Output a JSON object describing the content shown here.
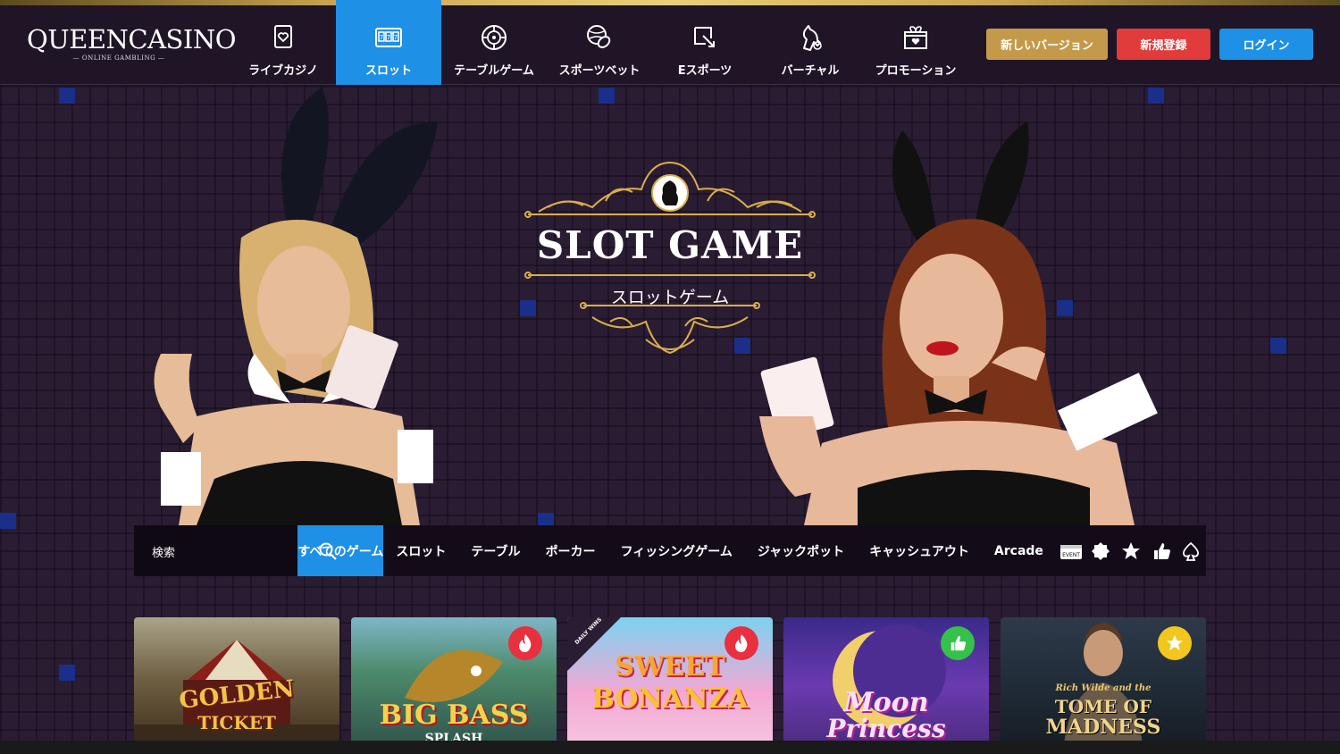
{
  "brand": {
    "name": "QueenCasino",
    "logo_text": "QUEENCASINO",
    "logo_sub": "— ONLINE GAMBLING —"
  },
  "nav": {
    "items": [
      {
        "label": "ライブカジノ",
        "icon": "live-casino-icon"
      },
      {
        "label": "スロット",
        "icon": "slot-777-icon",
        "active": true
      },
      {
        "label": "テーブルゲーム",
        "icon": "roulette-icon"
      },
      {
        "label": "スポーツベット",
        "icon": "sports-balls-icon"
      },
      {
        "label": "Eスポーツ",
        "icon": "esports-icon"
      },
      {
        "label": "バーチャル",
        "icon": "horse-icon"
      },
      {
        "label": "プロモーション",
        "icon": "gift-icon"
      }
    ]
  },
  "header_buttons": {
    "new_version": "新しいバージョン",
    "register": "新規登録",
    "login": "ログイン"
  },
  "hero": {
    "title": "SLOT GAME",
    "subtitle": "スロットゲーム"
  },
  "filter": {
    "search_placeholder": "検索",
    "tabs": [
      "すべてのゲーム",
      "スロット",
      "テーブル",
      "ポーカー",
      "フィッシングゲーム",
      "ジャックポット",
      "キャッシュアウト",
      "Arcade"
    ],
    "active_tab": "すべてのゲーム",
    "icons": [
      "event-icon",
      "badge-icon",
      "star-icon",
      "thumbs-up-icon",
      "spade-icon"
    ],
    "event_label": "EVENT"
  },
  "games": [
    {
      "title_line1": "GOLDEN",
      "title_line2": "TICKET",
      "badge": null
    },
    {
      "title_line1": "BIG BASS",
      "title_line2": "SPLASH",
      "badge": "hot"
    },
    {
      "title_line1": "SWEET",
      "title_line2": "BONANZA",
      "badge": "hot",
      "corner": "DAILY WINS"
    },
    {
      "title_line1": "Moon",
      "title_line2": "Princess",
      "badge": "recommended"
    },
    {
      "title_line0": "Rich Wilde and the",
      "title_line1": "TOME OF",
      "title_line2": "MADNESS",
      "badge": "favorite"
    }
  ],
  "colors": {
    "accent": "#1e90e6",
    "gold": "#c49a4a",
    "red": "#e23b3b",
    "background": "#2a1d33"
  }
}
